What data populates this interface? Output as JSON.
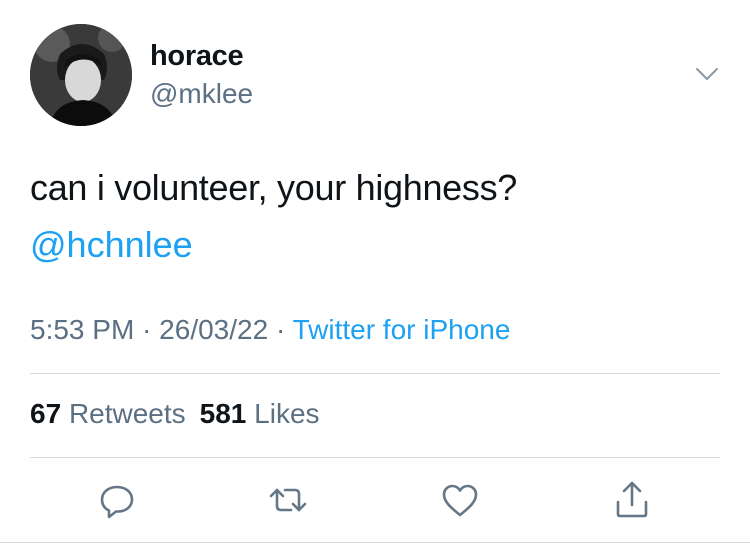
{
  "user": {
    "display_name": "horace",
    "handle": "@mklee"
  },
  "tweet": {
    "text": "can i volunteer, your highness?",
    "mention": "@hchnlee",
    "time": "5:53 PM",
    "separator": " · ",
    "date": "26/03/22",
    "source": "Twitter for iPhone"
  },
  "stats": {
    "retweets_count": "67",
    "retweets_label": "Retweets",
    "likes_count": "581",
    "likes_label": "Likes"
  },
  "icons": {
    "menu": "chevron-down-icon",
    "reply": "reply-icon",
    "retweet": "retweet-icon",
    "like": "heart-icon",
    "share": "share-icon"
  },
  "colors": {
    "accent": "#1da1f2",
    "secondary_text": "#5b7083",
    "primary_text": "#0f1419",
    "divider": "#d9d9d9"
  }
}
